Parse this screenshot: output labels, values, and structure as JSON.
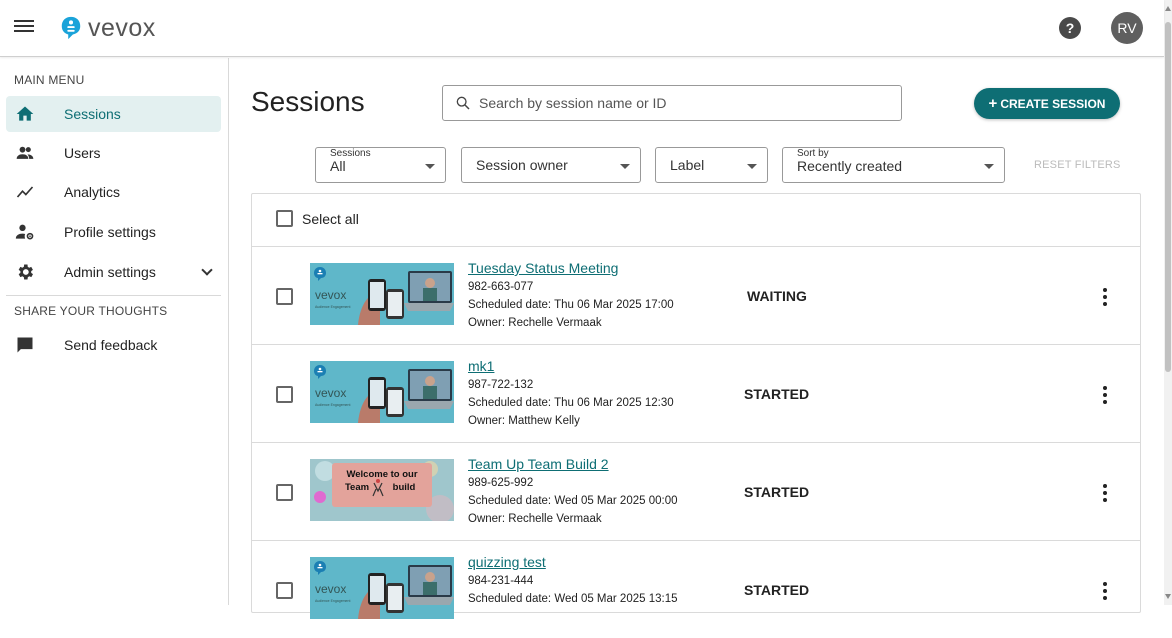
{
  "header": {
    "logo_text": "vevox",
    "help_symbol": "?",
    "avatar_initials": "RV",
    "brand_color": "#0e6e74"
  },
  "sidebar": {
    "main_menu_heading": "MAIN MENU",
    "items": [
      {
        "label": "Sessions",
        "icon": "home-icon",
        "active": true
      },
      {
        "label": "Users",
        "icon": "users-icon"
      },
      {
        "label": "Analytics",
        "icon": "analytics-icon"
      },
      {
        "label": "Profile settings",
        "icon": "profile-settings-icon"
      },
      {
        "label": "Admin settings",
        "icon": "gear-icon"
      }
    ],
    "share_heading": "SHARE YOUR THOUGHTS",
    "feedback_label": "Send feedback"
  },
  "main": {
    "title": "Sessions",
    "search_placeholder": "Search by session name or ID",
    "create_label": "CREATE SESSION",
    "filters": {
      "sessions_tiny": "Sessions",
      "sessions_value": "All",
      "owner": "Session owner",
      "label": "Label",
      "sort_tiny": "Sort by",
      "sort_value": "Recently created",
      "reset": "RESET FILTERS"
    },
    "select_all": "Select all",
    "sessions": [
      {
        "name": "Tuesday Status Meeting",
        "id": "982-663-077",
        "scheduled": "Scheduled date: Thu 06 Mar 2025 17:00",
        "owner": "Owner: Rechelle Vermaak",
        "status": "WAITING",
        "thumb": "vevox"
      },
      {
        "name": "mk1",
        "id": "987-722-132",
        "scheduled": "Scheduled date: Thu 06 Mar 2025 12:30",
        "owner": "Owner: Matthew Kelly",
        "status": "STARTED",
        "thumb": "vevox"
      },
      {
        "name": "Team Up Team Build 2",
        "id": "989-625-992",
        "scheduled": "Scheduled date: Wed 05 Mar 2025 00:00",
        "owner": "Owner: Rechelle Vermaak",
        "status": "STARTED",
        "thumb": "welcome",
        "thumb_text_1": "Welcome to our",
        "thumb_text_2": "Team",
        "thumb_text_3": "build"
      },
      {
        "name": "quizzing test",
        "id": "984-231-444",
        "scheduled": "Scheduled date: Wed 05 Mar 2025 13:15",
        "owner": "",
        "status": "STARTED",
        "thumb": "vevox"
      }
    ]
  }
}
